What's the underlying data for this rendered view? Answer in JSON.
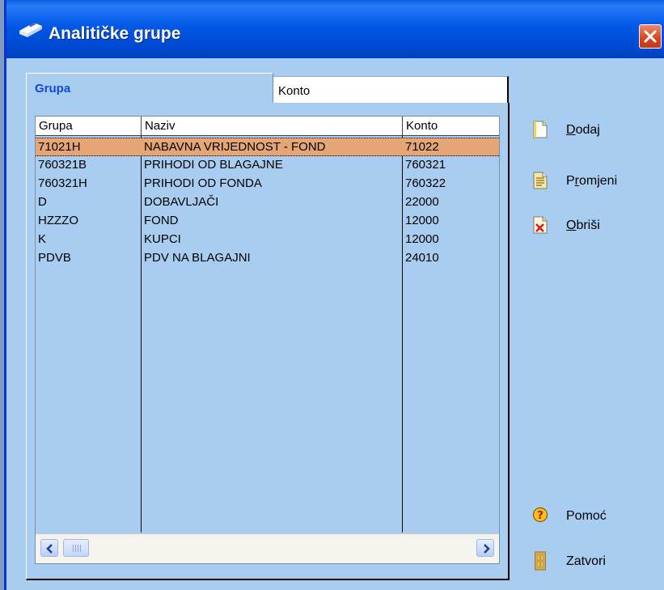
{
  "window": {
    "title": "Analitičke grupe"
  },
  "tabs": [
    {
      "label": "Grupa",
      "active": true
    },
    {
      "label": "Konto",
      "active": false
    }
  ],
  "grid": {
    "columns": [
      "Grupa",
      "Naziv",
      "Konto"
    ],
    "rows": [
      {
        "grupa": "71021H",
        "naziv": "NABAVNA VRIJEDNOST - FOND",
        "konto": "71022",
        "selected": true
      },
      {
        "grupa": "760321B",
        "naziv": "PRIHODI OD BLAGAJNE",
        "konto": "760321"
      },
      {
        "grupa": "760321H",
        "naziv": "PRIHODI OD FONDA",
        "konto": "760322"
      },
      {
        "grupa": "D",
        "naziv": "DOBAVLJAČI",
        "konto": "22000"
      },
      {
        "grupa": "HZZZO",
        "naziv": "FOND",
        "konto": "12000"
      },
      {
        "grupa": "K",
        "naziv": "KUPCI",
        "konto": "12000"
      },
      {
        "grupa": "PDVB",
        "naziv": "PDV NA BLAGAJNI",
        "konto": "24010"
      }
    ]
  },
  "actions": {
    "dodaj": {
      "access": "D",
      "rest": "odaj"
    },
    "promjeni": {
      "pre": "P",
      "access": "r",
      "rest": "omjeni"
    },
    "obrisi": {
      "access": "O",
      "rest": "briši"
    },
    "pomoc": "Pomoć",
    "zatvori": "Zatvori"
  },
  "colors": {
    "titlebar": "#0058e6",
    "client_bg": "#a9cdf0",
    "selected_row": "#e6a574",
    "active_tab_text": "#1048d8"
  }
}
